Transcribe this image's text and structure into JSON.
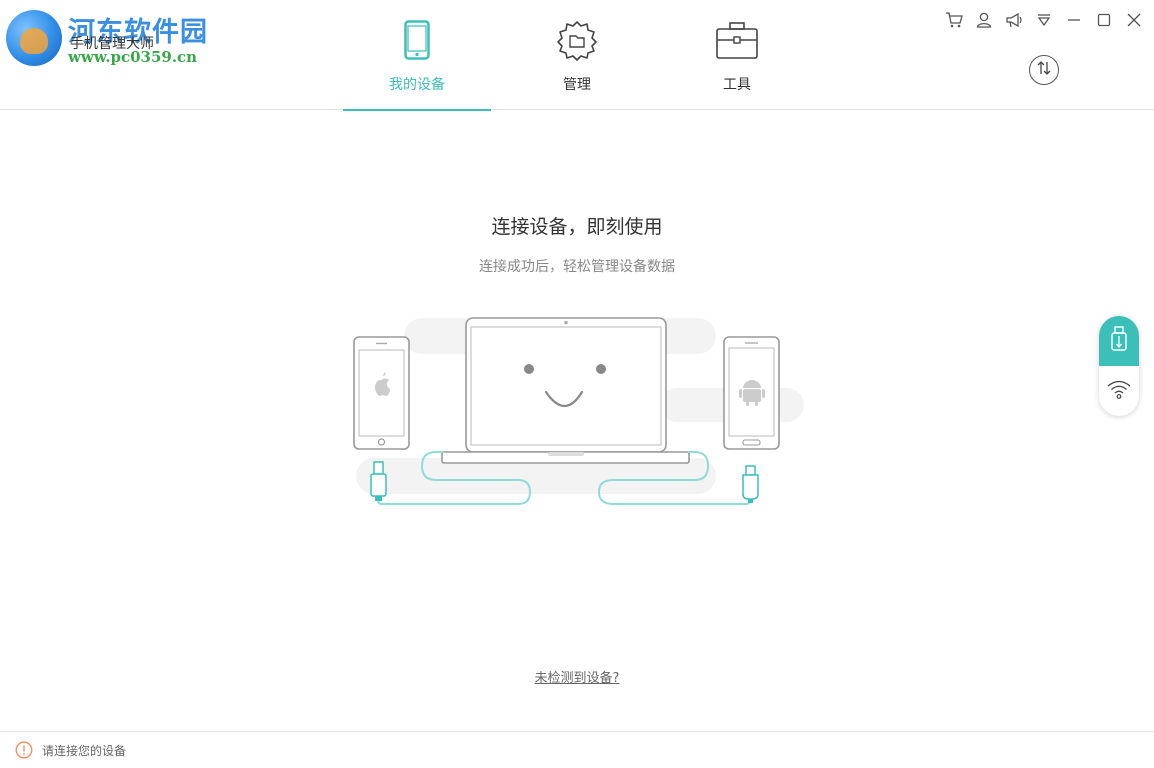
{
  "branding": {
    "site_name": "河东软件园",
    "app_name": "手机管理大师",
    "site_url": "www.pc0359.cn"
  },
  "tabs": [
    {
      "label": "我的设备",
      "icon": "phone-icon",
      "active": true
    },
    {
      "label": "管理",
      "icon": "gear-folder-icon",
      "active": false
    },
    {
      "label": "工具",
      "icon": "toolbox-icon",
      "active": false
    }
  ],
  "window_controls": [
    "cart-icon",
    "user-icon",
    "megaphone-icon",
    "dropdown-menu-icon",
    "minimize-icon",
    "maximize-icon",
    "close-icon"
  ],
  "main": {
    "title": "连接设备，即刻使用",
    "subtitle": "连接成功后，轻松管理设备数据",
    "help_link": "未检测到设备?"
  },
  "connection_panel": {
    "modes": [
      "usb-icon",
      "wifi-icon"
    ],
    "active_mode": "usb-icon"
  },
  "status": {
    "text": "请连接您的设备"
  },
  "colors": {
    "accent": "#3cbfb8",
    "text": "#333333",
    "muted": "#888888",
    "border": "#e6e6e6",
    "warning": "#f08a5d"
  }
}
